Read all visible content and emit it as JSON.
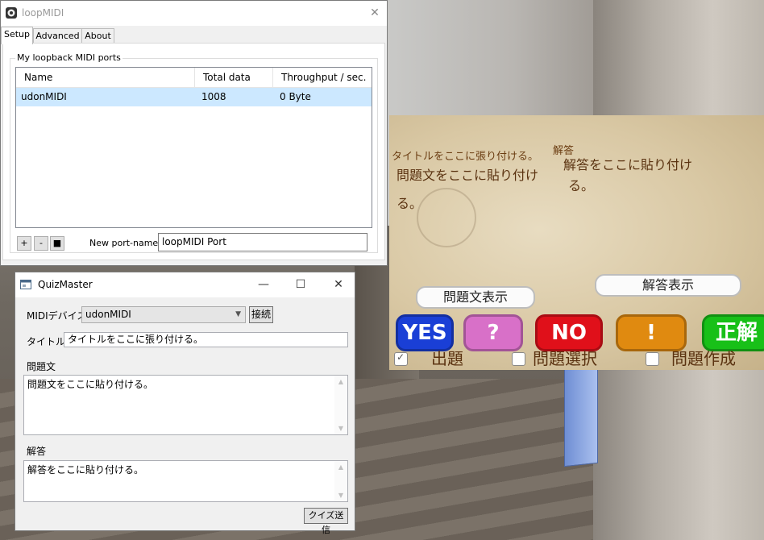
{
  "loopmidi": {
    "title": "loopMIDI",
    "close_glyph": "✕",
    "tabs": [
      {
        "label": "Setup"
      },
      {
        "label": "Advanced"
      },
      {
        "label": "About"
      }
    ],
    "group_label": "My loopback MIDI ports",
    "columns": [
      "Name",
      "Total data",
      "Throughput / sec."
    ],
    "rows": [
      {
        "name": "udonMIDI",
        "total": "1008",
        "throughput": "0 Byte"
      }
    ],
    "add_label": "+",
    "remove_label": "-",
    "stop_label": "■",
    "new_port_label": "New port-name:",
    "new_port_value": "loopMIDI Port"
  },
  "quizmaster": {
    "title": "QuizMaster",
    "minimize_glyph": "—",
    "maximize_glyph": "☐",
    "close_glyph": "✕",
    "midi_label": "MIDIデバイス",
    "midi_selected": "udonMIDI",
    "connect_label": "接続",
    "title_label": "タイトル",
    "title_value": "タイトルをここに張り付ける。",
    "question_label": "問題文",
    "question_value": "問題文をここに貼り付ける。",
    "answer_label": "解答",
    "answer_value": "解答をここに貼り付ける。",
    "send_label": "クイズ送信"
  },
  "board": {
    "title_text": "タイトルをここに張り付ける。",
    "answer_heading": "解答",
    "question_line1": "問題文をここに貼り付け",
    "question_line2": "る。",
    "answer_line1": "解答をここに貼り付け",
    "answer_line2": "る。",
    "show_question": "問題文表示",
    "show_answer": "解答表示",
    "buttons": [
      {
        "label": "YES",
        "color": "#1a3fd6"
      },
      {
        "label": "?",
        "color": "#d870c8"
      },
      {
        "label": "NO",
        "color": "#e0101a"
      },
      {
        "label": "!",
        "color": "#e08a10"
      },
      {
        "label": "正解",
        "color": "#18c018"
      }
    ],
    "check_glyph": "✓",
    "checks": [
      {
        "label": "出題",
        "checked": true
      },
      {
        "label": "問題選択",
        "checked": false
      },
      {
        "label": "問題作成",
        "checked": false
      }
    ]
  }
}
